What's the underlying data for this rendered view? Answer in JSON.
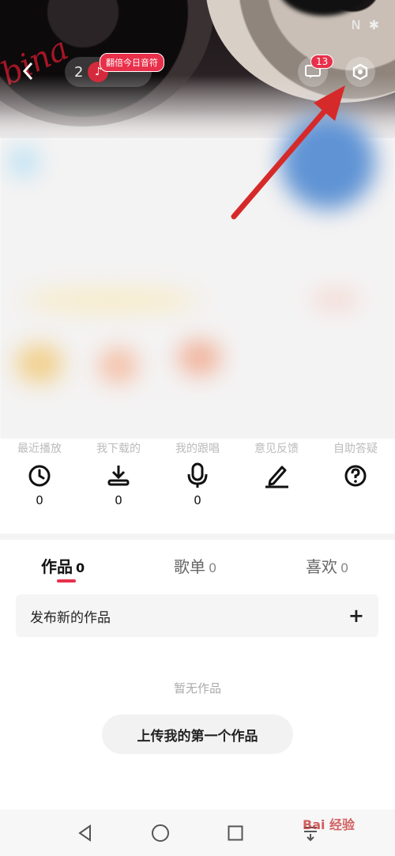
{
  "header": {
    "album_lettering": "bina",
    "visitor_count": "2",
    "promo_badge": "翻倍今日音符",
    "message_badge": "13",
    "back_icon": "chevron-left-icon",
    "message_icon": "message-icon",
    "settings_icon": "hexagon-settings-icon",
    "status_icons": [
      "nfc-icon",
      "bluetooth-icon"
    ]
  },
  "quick_actions": [
    {
      "label": "最近播放",
      "count": "0",
      "icon": "clock-icon"
    },
    {
      "label": "我下载的",
      "count": "0",
      "icon": "download-icon"
    },
    {
      "label": "我的跟唱",
      "count": "0",
      "icon": "microphone-icon"
    },
    {
      "label": "意见反馈",
      "count": "",
      "icon": "pen-icon"
    },
    {
      "label": "自助答疑",
      "count": "",
      "icon": "help-icon"
    }
  ],
  "tabs": [
    {
      "label": "作品",
      "count": "0",
      "active": true
    },
    {
      "label": "歌单",
      "count": "0",
      "active": false
    },
    {
      "label": "喜欢",
      "count": "0",
      "active": false
    }
  ],
  "publish": {
    "label": "发布新的作品",
    "plus": "+"
  },
  "empty_state": {
    "text": "暂无作品",
    "button": "上传我的第一个作品"
  },
  "nav": [
    "back-triangle-icon",
    "home-circle-icon",
    "recents-square-icon",
    "notification-pulldown-icon"
  ],
  "watermark": "Bai 经验",
  "colors": {
    "accent": "#e8304a",
    "annotation_arrow": "#d62a2a"
  }
}
